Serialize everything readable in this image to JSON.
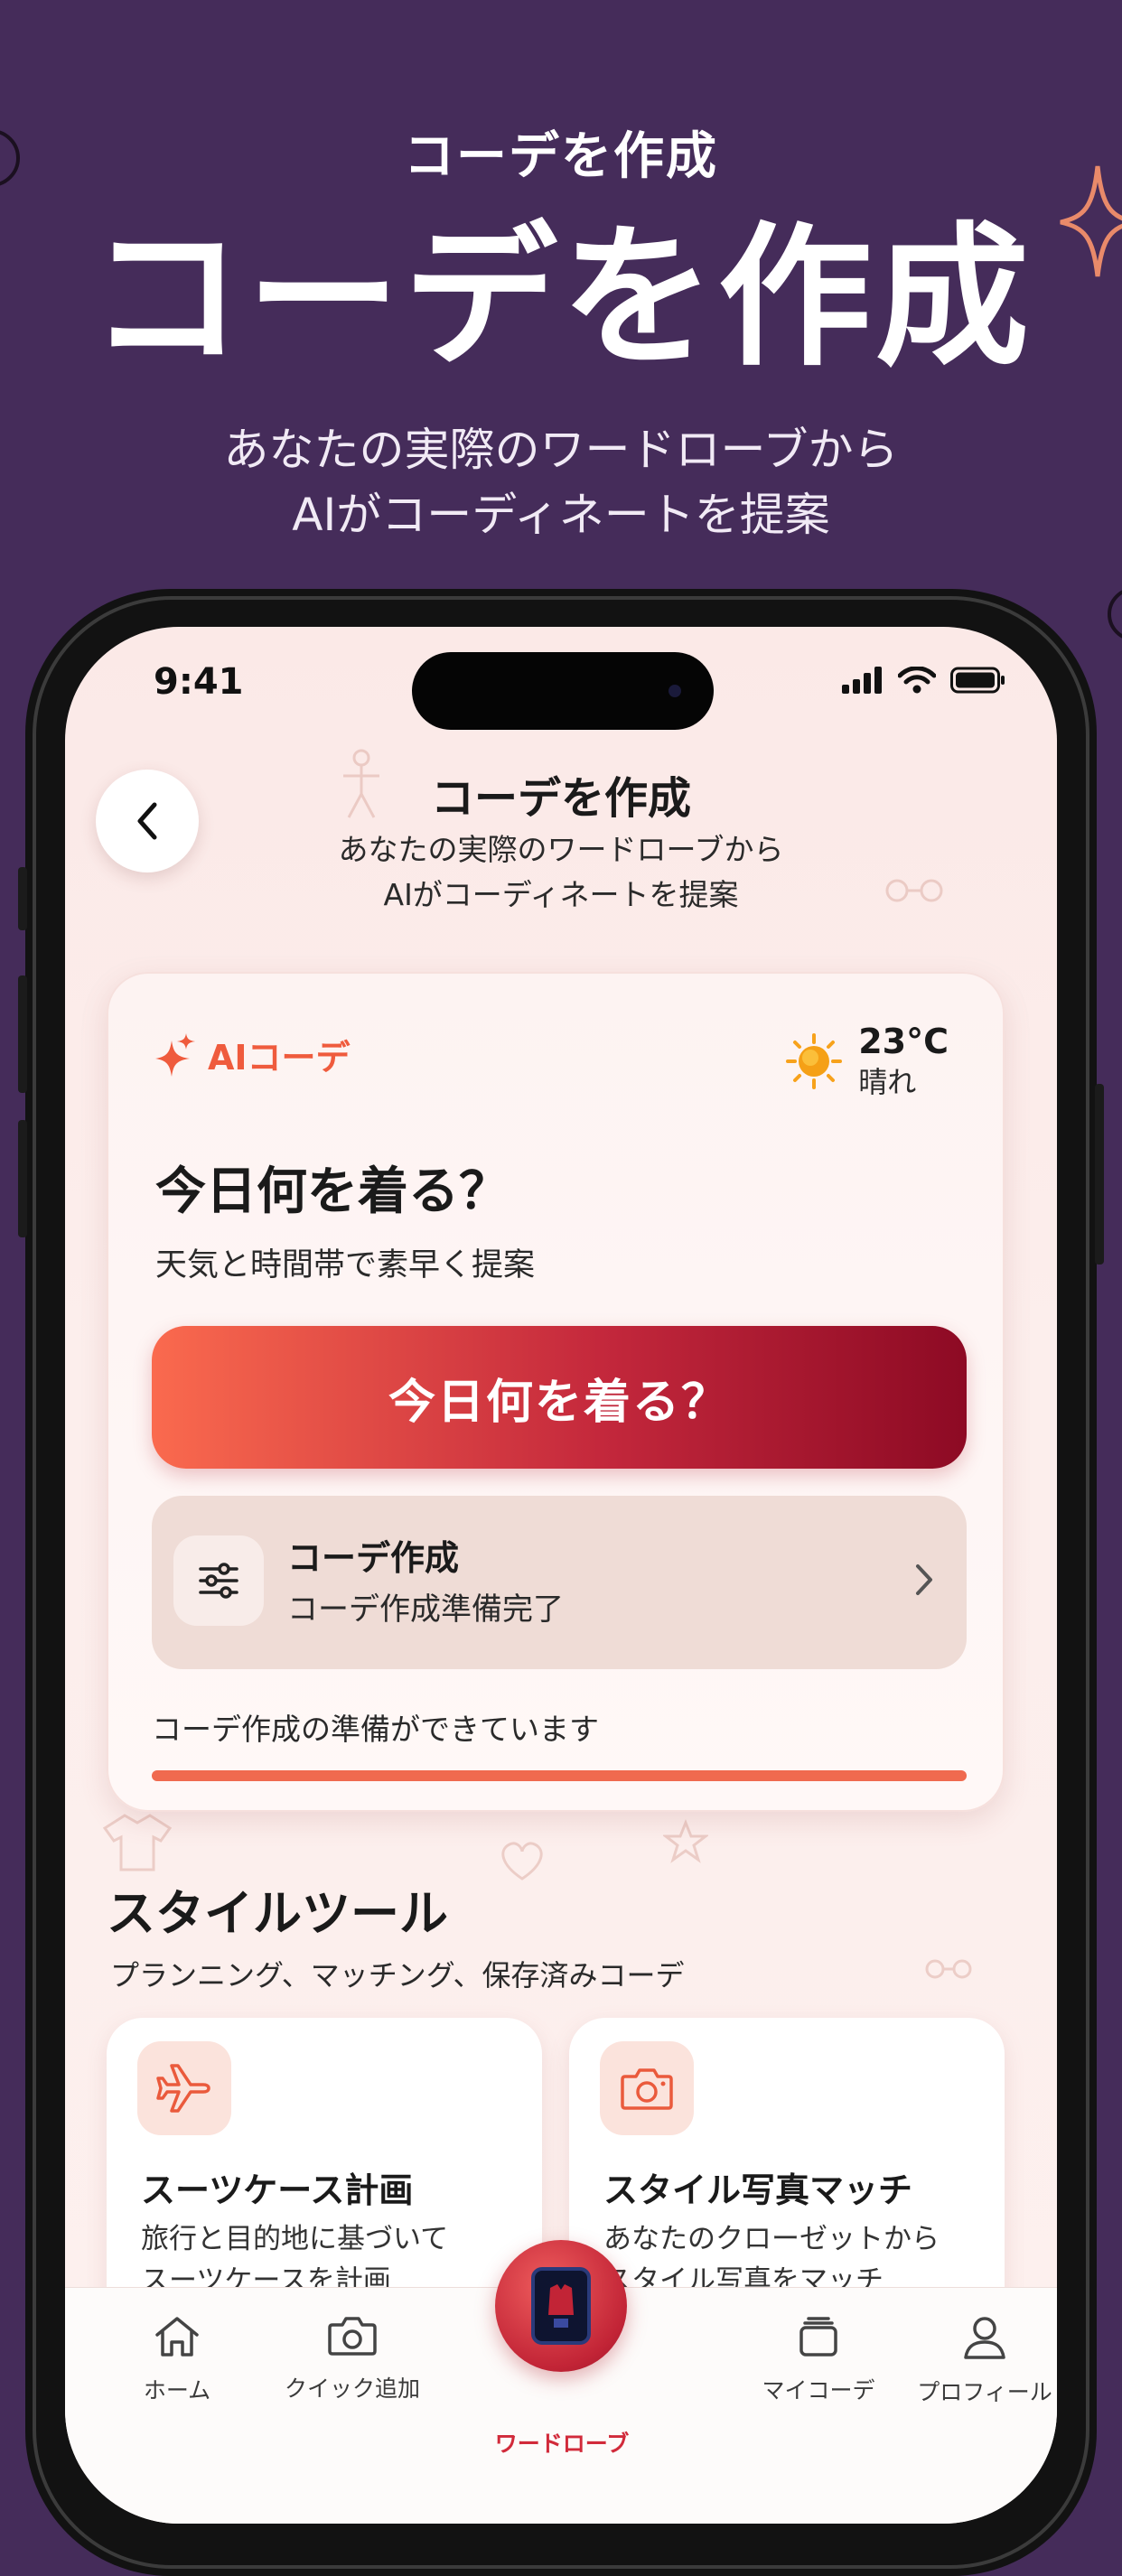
{
  "promo": {
    "small_title": "コーデを作成",
    "big_title": "コーデを作成",
    "subtitle_line1": "あなたの実際のワードローブから",
    "subtitle_line2": "AIがコーディネートを提案"
  },
  "status_bar": {
    "time": "9:41"
  },
  "header": {
    "title": "コーデを作成",
    "subtitle_line1": "あなたの実際のワードローブから",
    "subtitle_line2": "AIがコーディネートを提案"
  },
  "ai_card": {
    "badge": "AIコーデ",
    "weather": {
      "temp": "23°C",
      "condition": "晴れ"
    },
    "headline": "今日何を着る？",
    "description": "天気と時間帯で素早く提案",
    "primary_button": "今日何を着る？",
    "create_row": {
      "title": "コーデ作成",
      "subtitle": "コーデ作成準備完了"
    },
    "ready_text": "コーデ作成の準備ができています",
    "progress": 1.0
  },
  "style_tools": {
    "title": "スタイルツール",
    "subtitle": "プランニング、マッチング、保存済みコーデ",
    "cards": [
      {
        "title": "スーツケース計画",
        "desc_line1": "旅行と目的地に基づいて",
        "desc_line2": "スーツケースを計画",
        "icon": "airplane-icon"
      },
      {
        "title": "スタイル写真マッチ",
        "desc_line1": "あなたのクローゼットから",
        "desc_line2": "スタイル写真をマッチ",
        "icon": "camera-icon"
      }
    ]
  },
  "tabbar": {
    "home": "ホーム",
    "quick_add": "クイック追加",
    "wardrobe": "ワードローブ",
    "my_outfits": "マイコーデ",
    "profile": "プロフィール"
  },
  "colors": {
    "background": "#452c5a",
    "accent": "#ef5b3d",
    "button_start": "#fa6a4e",
    "button_end": "#8d0a24",
    "active_tab": "#d12a3a"
  }
}
